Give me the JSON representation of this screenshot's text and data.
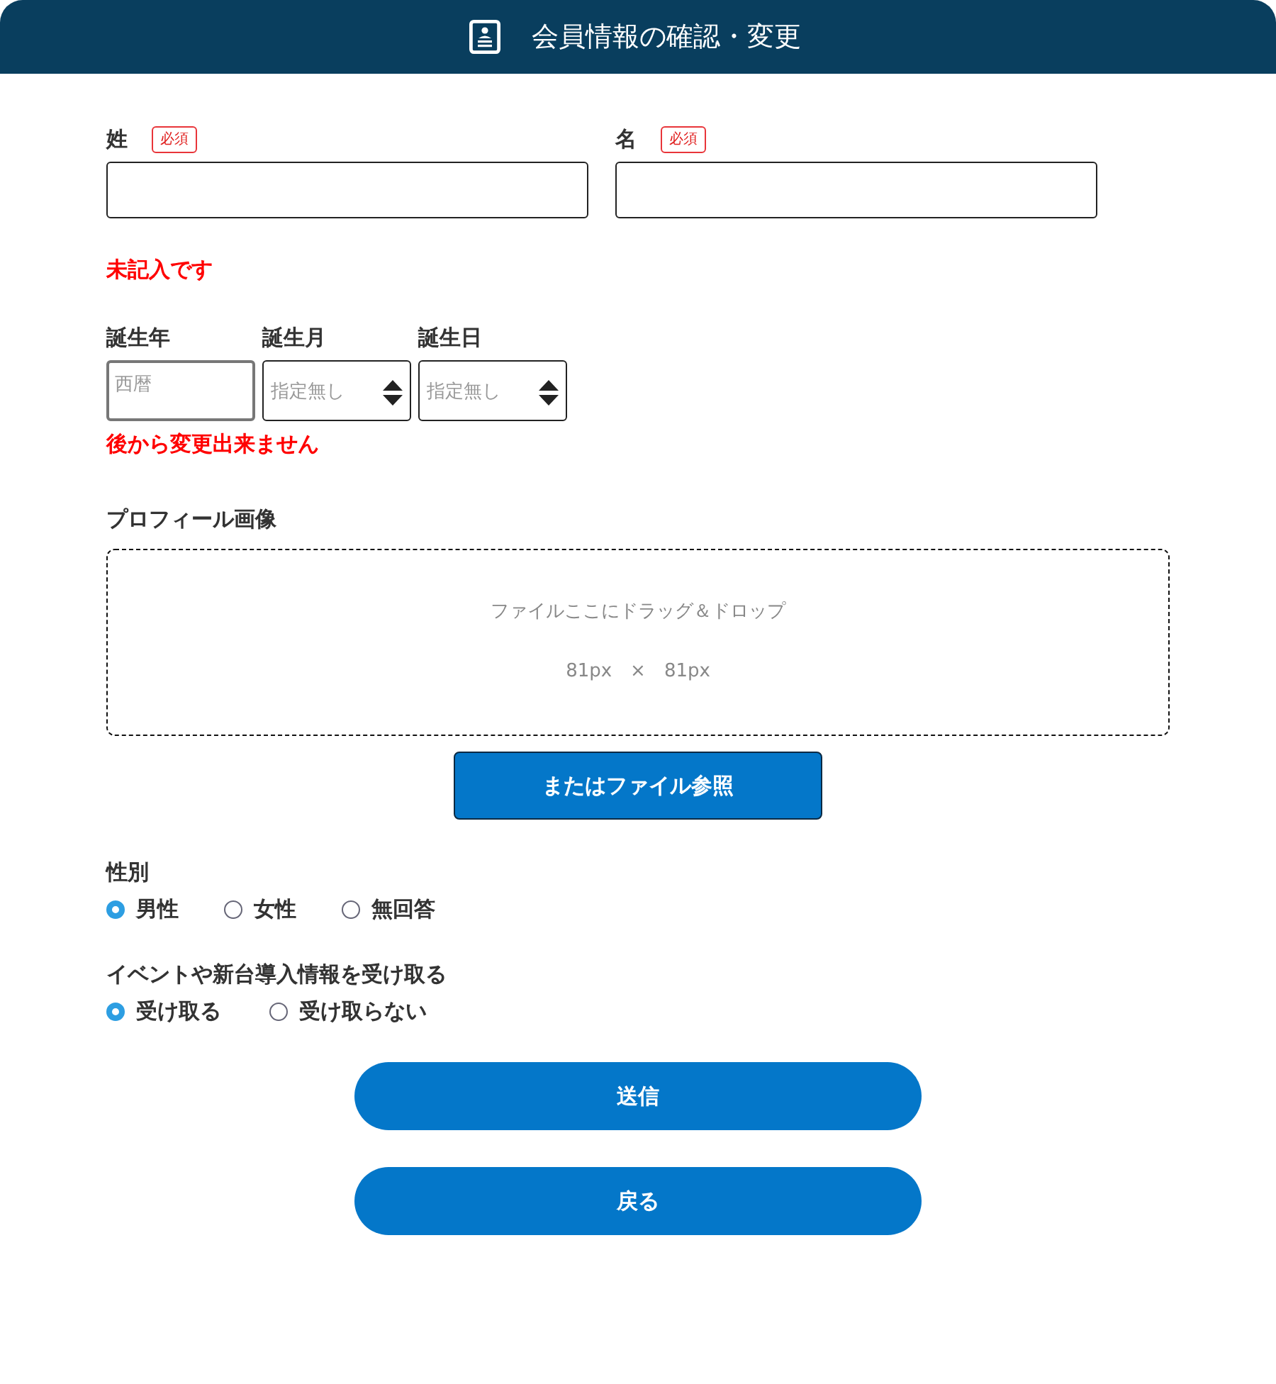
{
  "header": {
    "title": "会員情報の確認・変更"
  },
  "name_fields": [
    {
      "label": "姓",
      "badge": "必須"
    },
    {
      "label": "名",
      "badge": "必須"
    }
  ],
  "name_error": "未記入です",
  "birth_fields": [
    {
      "label": "誕生年",
      "kind": "input",
      "placeholder": "西暦"
    },
    {
      "label": "誕生月",
      "kind": "select",
      "placeholder": "指定無し"
    },
    {
      "label": "誕生日",
      "kind": "select",
      "placeholder": "指定無し"
    }
  ],
  "birth_note": "後から変更出来ません",
  "profile_image": {
    "label": "プロフィール画像",
    "drop_text": "ファイルここにドラッグ＆ドロップ",
    "size_text": "81px　×　81px",
    "browse_button": "またはファイル参照"
  },
  "gender": {
    "label": "性別",
    "options": [
      {
        "label": "男性",
        "selected": true
      },
      {
        "label": "女性",
        "selected": false
      },
      {
        "label": "無回答",
        "selected": false
      }
    ]
  },
  "newsletter": {
    "label": "イベントや新台導入情報を受け取る",
    "options": [
      {
        "label": "受け取る",
        "selected": true
      },
      {
        "label": "受け取らない",
        "selected": false
      }
    ]
  },
  "buttons": [
    {
      "label": "送信"
    },
    {
      "label": "戻る"
    }
  ]
}
